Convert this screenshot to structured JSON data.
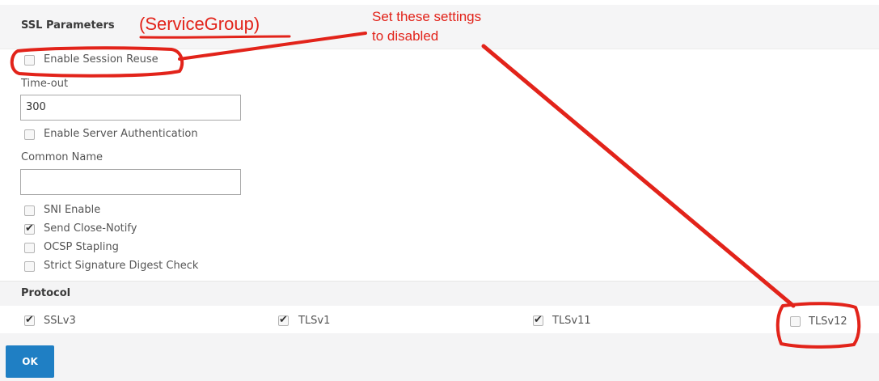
{
  "ssl_section": {
    "title": "SSL Parameters"
  },
  "annotations": {
    "title": "(ServiceGroup)",
    "note": "Set these settings\nto disabled",
    "color": "#e2231a"
  },
  "fields": {
    "enable_session_reuse": {
      "label": "Enable Session Reuse",
      "checked": false
    },
    "timeout": {
      "label": "Time-out",
      "value": "300"
    },
    "enable_server_auth": {
      "label": "Enable Server Authentication",
      "checked": false
    },
    "common_name": {
      "label": "Common Name",
      "value": ""
    },
    "sni_enable": {
      "label": "SNI Enable",
      "checked": false
    },
    "send_close_notify": {
      "label": "Send Close-Notify",
      "checked": true
    },
    "ocsp_stapling": {
      "label": "OCSP Stapling",
      "checked": false
    },
    "strict_sig_digest": {
      "label": "Strict Signature Digest Check",
      "checked": false
    }
  },
  "protocol_section": {
    "title": "Protocol",
    "items": [
      {
        "label": "SSLv3",
        "checked": true
      },
      {
        "label": "TLSv1",
        "checked": true
      },
      {
        "label": "TLSv11",
        "checked": true
      },
      {
        "label": "TLSv12",
        "checked": false
      }
    ]
  },
  "footer": {
    "ok_label": "OK",
    "accent": "#1f7fc4"
  }
}
